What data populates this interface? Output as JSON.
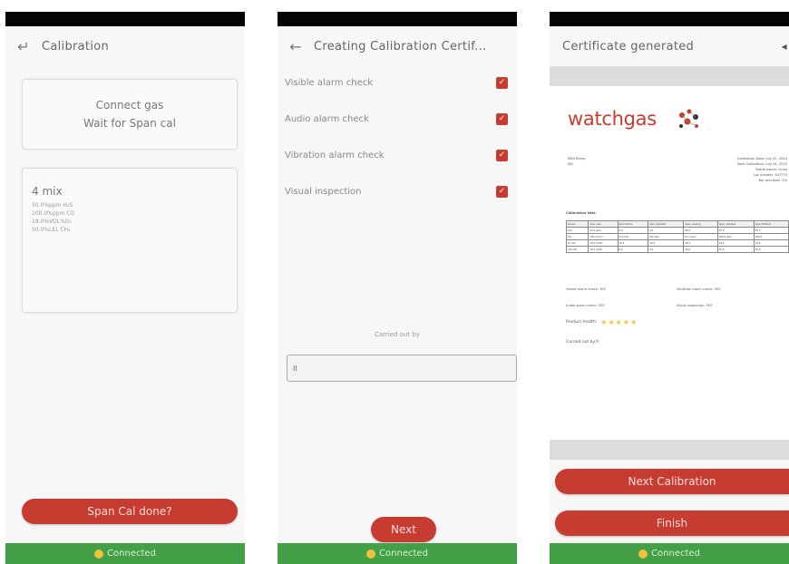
{
  "connection": {
    "label": "Connected"
  },
  "screen1": {
    "title": "Calibration",
    "instruction_line1": "Connect gas",
    "instruction_line2": "Wait for Span cal",
    "mix_title": "4 mix",
    "gas_lines": [
      "50.0%ppm H₂S",
      "100.0%ppm CO",
      "18.0%VOL%O₂",
      "50.0%LEL CH₄"
    ],
    "span_button": "Span Cal done?"
  },
  "screen2": {
    "title": "Creating Calibration Certif...",
    "checks": [
      {
        "label": "Visible alarm check",
        "checked": true
      },
      {
        "label": "Audio alarm check",
        "checked": true
      },
      {
        "label": "Vibration alarm check",
        "checked": true
      },
      {
        "label": "Visual inspection",
        "checked": true
      }
    ],
    "carried_label": "Carried out by",
    "carried_value": "II",
    "next_button": "Next"
  },
  "screen3": {
    "title": "Certificate generated",
    "logo_text": "watchgas",
    "device_name": "MX4 Ramp",
    "device_sub": "SN:",
    "cal_date": "Calibration Date: July 25, 2024",
    "next_cal": "Next Calibration: July 24, 2025",
    "bottle_owner": "Bottle owner: d-rep",
    "lot_number": "Lot number: 307774",
    "precision": "Bar precision: 3%",
    "table_heading": "Calibration data",
    "table_headers": [
      "Sensor",
      "Span Gas",
      "Zero before",
      "Zero adjusted",
      "Span reading",
      "Span adjusted",
      "Span Bottle%"
    ],
    "table_rows": [
      [
        "H₂S",
        "50.0 ppm",
        "0.0",
        "0.0",
        "48.0",
        "50.0",
        "50.0"
      ],
      [
        "CO",
        "100.0 ppm",
        "0.0 ppm",
        "0.0 ppm",
        "97.0 ppm",
        "100.0 ppm",
        "100.0"
      ],
      [
        "O₂ Cell",
        "18.0 %VOL",
        "20.9",
        "20.9",
        "18.2",
        "18.0",
        "18.0"
      ],
      [
        "CH₄ LEL",
        "50.0 %LEL",
        "0.0",
        "0.0",
        "49.0",
        "50.0",
        "50.0"
      ]
    ],
    "visible_alarm": "Visible alarm check: YES",
    "vibration_alarm": "Vibration alarm check: YES",
    "audio_alarm": "Audio alarm check: YES",
    "visual_inspection": "Visual inspection: YES",
    "product_health_label": "Product health:",
    "product_health_stars": "★★★★★",
    "carried_out": "Carried out by:II",
    "next_cal_button": "Next Calibration",
    "finish_button": "Finish"
  },
  "colors": {
    "accent": "#c73c31",
    "connected": "#43a047",
    "status_bar": "#050505"
  }
}
